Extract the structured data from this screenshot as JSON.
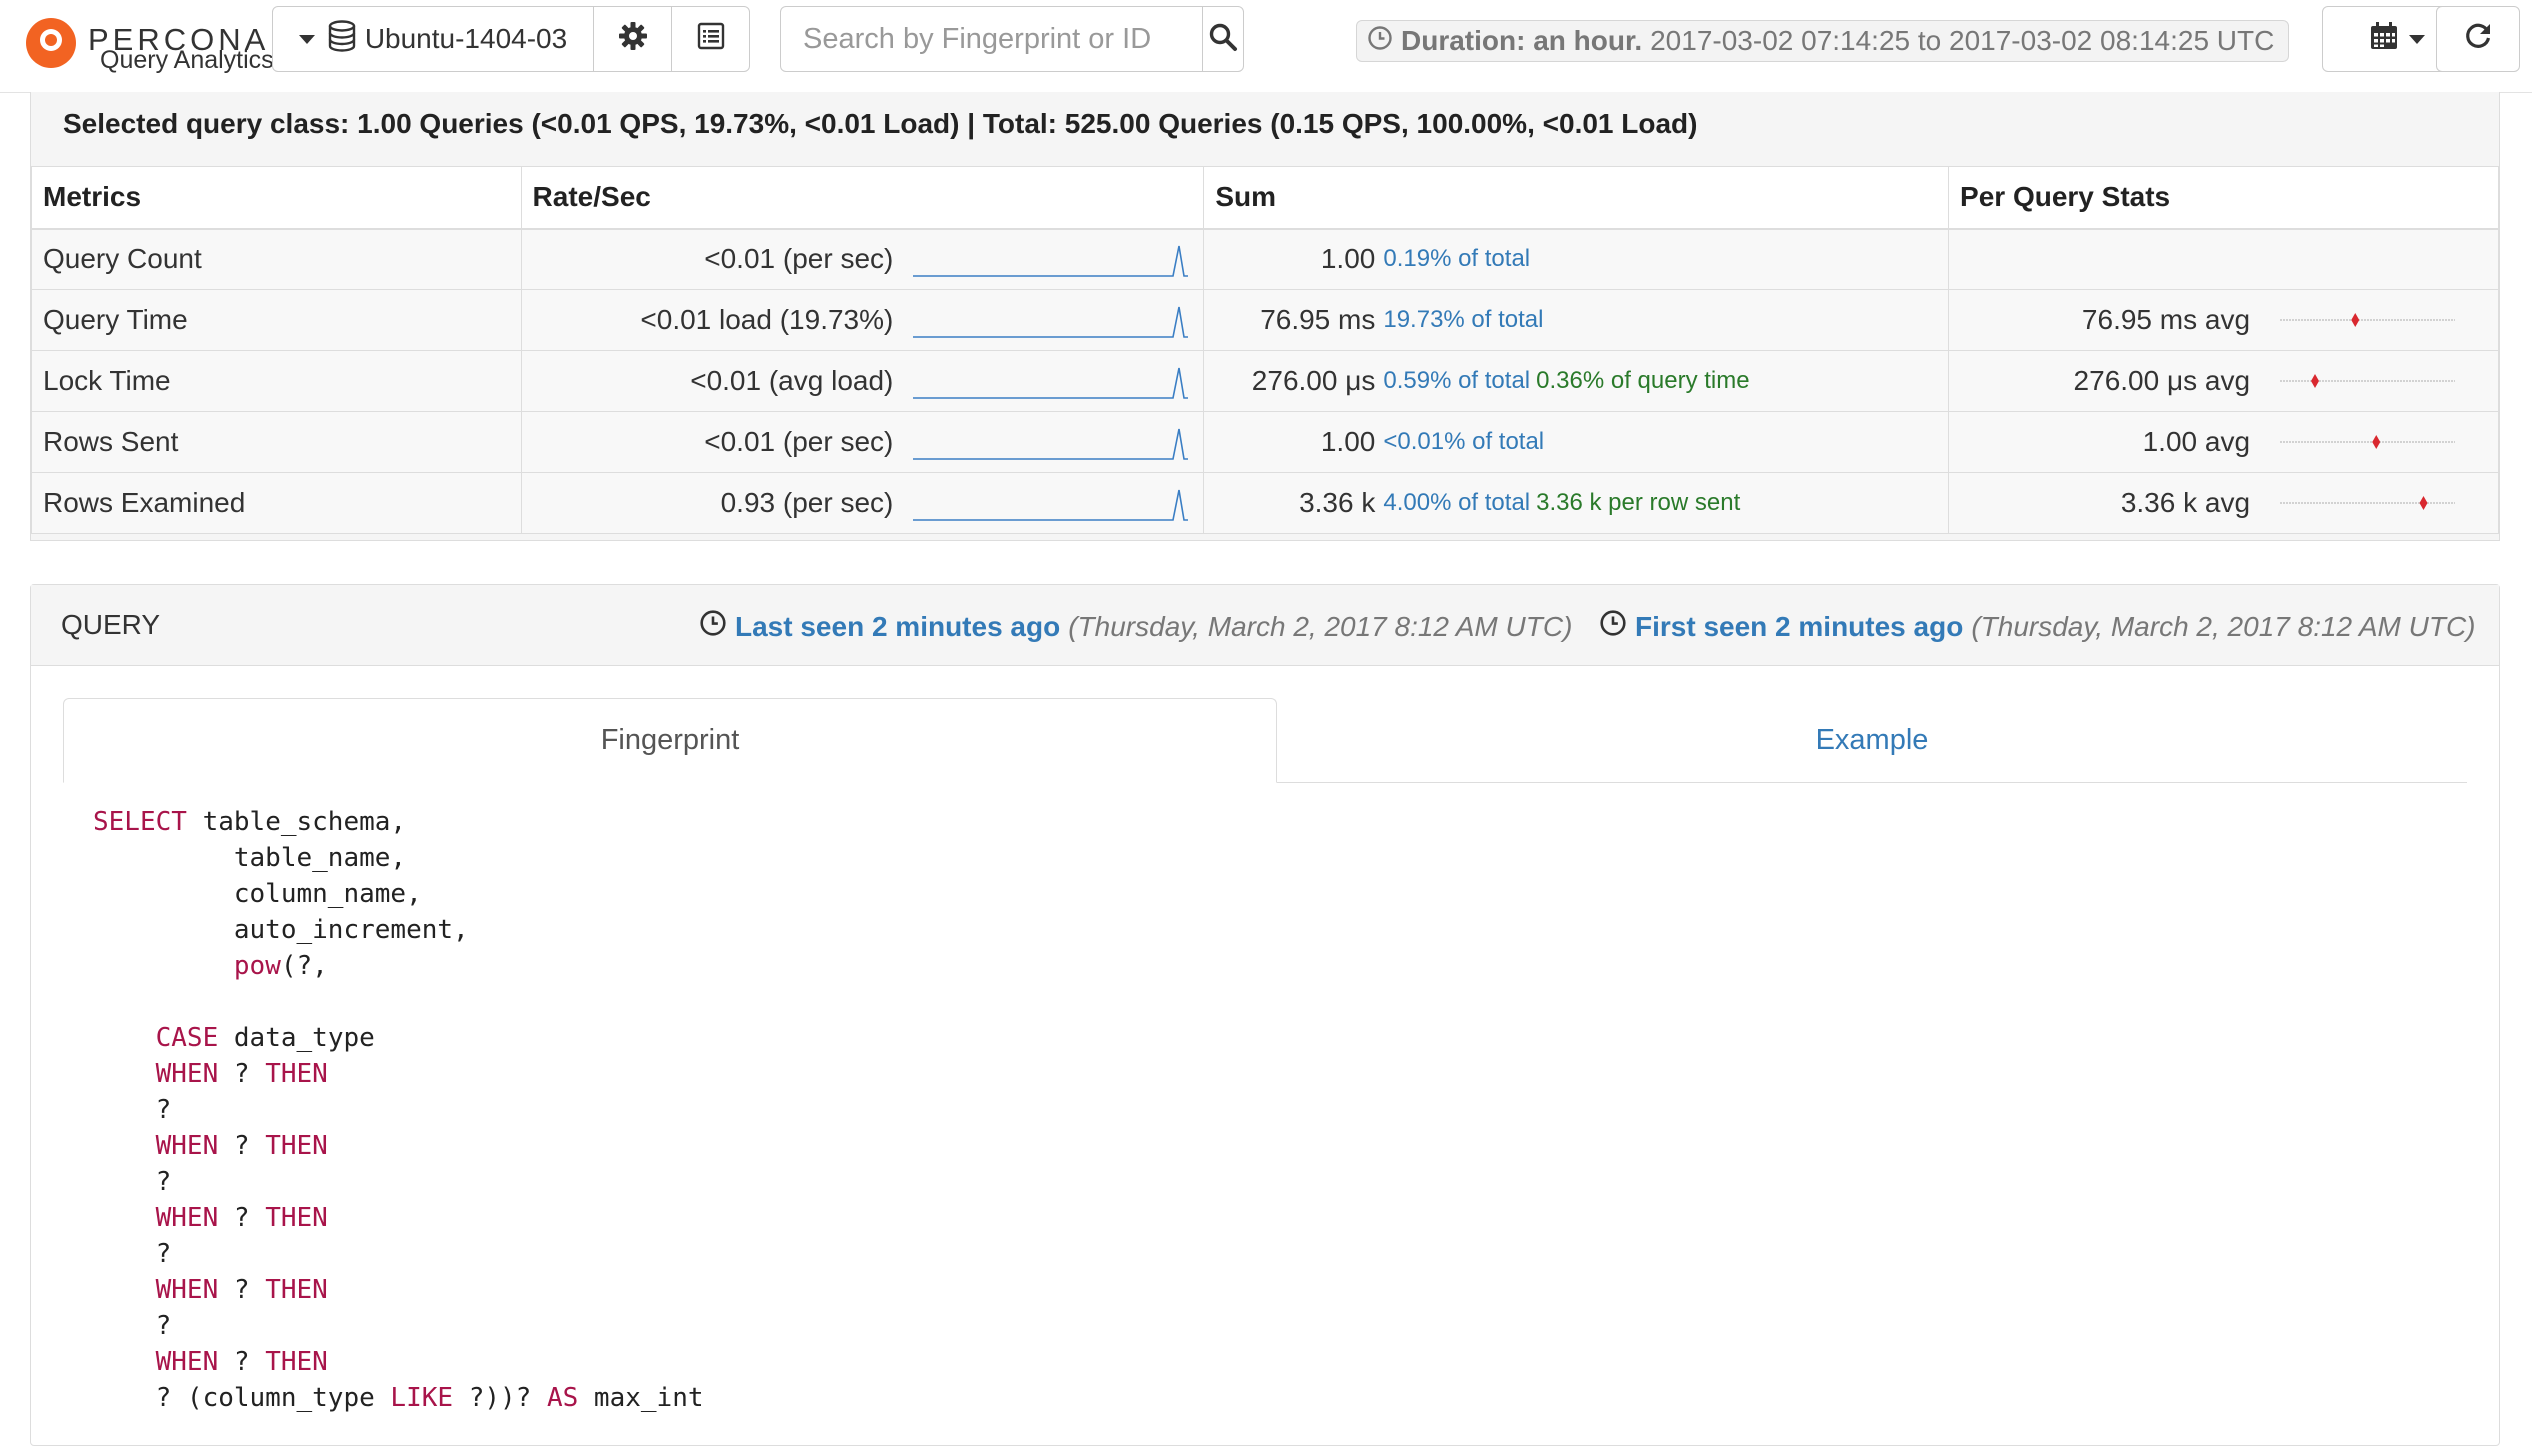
{
  "brand": {
    "name": "PERCONA",
    "subtitle": "Query Analytics"
  },
  "toolbar": {
    "instance": "Ubuntu-1404-03",
    "search_placeholder": "Search by Fingerprint or ID",
    "duration_label": "Duration: an hour.",
    "duration_range": "2017-03-02 07:14:25 to 2017-03-02 08:14:25 UTC"
  },
  "summary": {
    "title": "Selected query class: 1.00 Queries (<0.01 QPS, 19.73%, <0.01 Load) | Total: 525.00 Queries (0.15 QPS, 100.00%, <0.01 Load)",
    "headers": {
      "metrics": "Metrics",
      "rate": "Rate/Sec",
      "sum": "Sum",
      "per_query": "Per Query Stats"
    },
    "rows": [
      {
        "metric": "Query Count",
        "rate": "<0.01 (per sec)",
        "sum": "1.00",
        "pct": "0.19% of total",
        "extra": "",
        "pq": "",
        "dot": null
      },
      {
        "metric": "Query Time",
        "rate": "<0.01 load (19.73%)",
        "sum": "76.95 ms",
        "pct": "19.73% of total",
        "extra": "",
        "pq": "76.95 ms avg",
        "dot": 0.43
      },
      {
        "metric": "Lock Time",
        "rate": "<0.01 (avg load)",
        "sum": "276.00 μs",
        "pct": "0.59% of total",
        "extra": "0.36% of query time",
        "pq": "276.00 μs avg",
        "dot": 0.2
      },
      {
        "metric": "Rows Sent",
        "rate": "<0.01 (per sec)",
        "sum": "1.00",
        "pct": "<0.01% of total",
        "extra": "",
        "pq": "1.00  avg",
        "dot": 0.55
      },
      {
        "metric": "Rows Examined",
        "rate": "0.93 (per sec)",
        "sum": "3.36 k",
        "pct": "4.00% of total",
        "extra": "3.36 k per row sent",
        "pq": "3.36 k avg",
        "dot": 0.82
      }
    ]
  },
  "query": {
    "title": "QUERY",
    "last_seen": "Last seen 2 minutes ago",
    "last_seen_date": "(Thursday, March 2, 2017 8:12 AM UTC)",
    "first_seen": "First seen 2 minutes ago",
    "first_seen_date": "(Thursday, March 2, 2017 8:12 AM UTC)",
    "tabs": [
      "Fingerprint",
      "Example"
    ],
    "code_lines": [
      [
        [
          "kw",
          "SELECT"
        ],
        [
          "t",
          " table_schema,"
        ]
      ],
      [
        [
          "t",
          "         table_name,"
        ]
      ],
      [
        [
          "t",
          "         column_name,"
        ]
      ],
      [
        [
          "t",
          "         auto_increment,"
        ]
      ],
      [
        [
          "t",
          "         "
        ],
        [
          "kw",
          "pow"
        ],
        [
          "t",
          "(?,"
        ]
      ],
      [
        [
          "t",
          ""
        ]
      ],
      [
        [
          "t",
          "    "
        ],
        [
          "kw",
          "CASE"
        ],
        [
          "t",
          " data_type"
        ]
      ],
      [
        [
          "t",
          "    "
        ],
        [
          "kw",
          "WHEN"
        ],
        [
          "t",
          " ? "
        ],
        [
          "kw",
          "THEN"
        ]
      ],
      [
        [
          "t",
          "    ?"
        ]
      ],
      [
        [
          "t",
          "    "
        ],
        [
          "kw",
          "WHEN"
        ],
        [
          "t",
          " ? "
        ],
        [
          "kw",
          "THEN"
        ]
      ],
      [
        [
          "t",
          "    ?"
        ]
      ],
      [
        [
          "t",
          "    "
        ],
        [
          "kw",
          "WHEN"
        ],
        [
          "t",
          " ? "
        ],
        [
          "kw",
          "THEN"
        ]
      ],
      [
        [
          "t",
          "    ?"
        ]
      ],
      [
        [
          "t",
          "    "
        ],
        [
          "kw",
          "WHEN"
        ],
        [
          "t",
          " ? "
        ],
        [
          "kw",
          "THEN"
        ]
      ],
      [
        [
          "t",
          "    ?"
        ]
      ],
      [
        [
          "t",
          "    "
        ],
        [
          "kw",
          "WHEN"
        ],
        [
          "t",
          " ? "
        ],
        [
          "kw",
          "THEN"
        ]
      ],
      [
        [
          "t",
          "    ? (column_type "
        ],
        [
          "kw",
          "LIKE"
        ],
        [
          "t",
          " ?))? "
        ],
        [
          "kw",
          "AS"
        ],
        [
          "t",
          " max_int"
        ]
      ]
    ]
  }
}
